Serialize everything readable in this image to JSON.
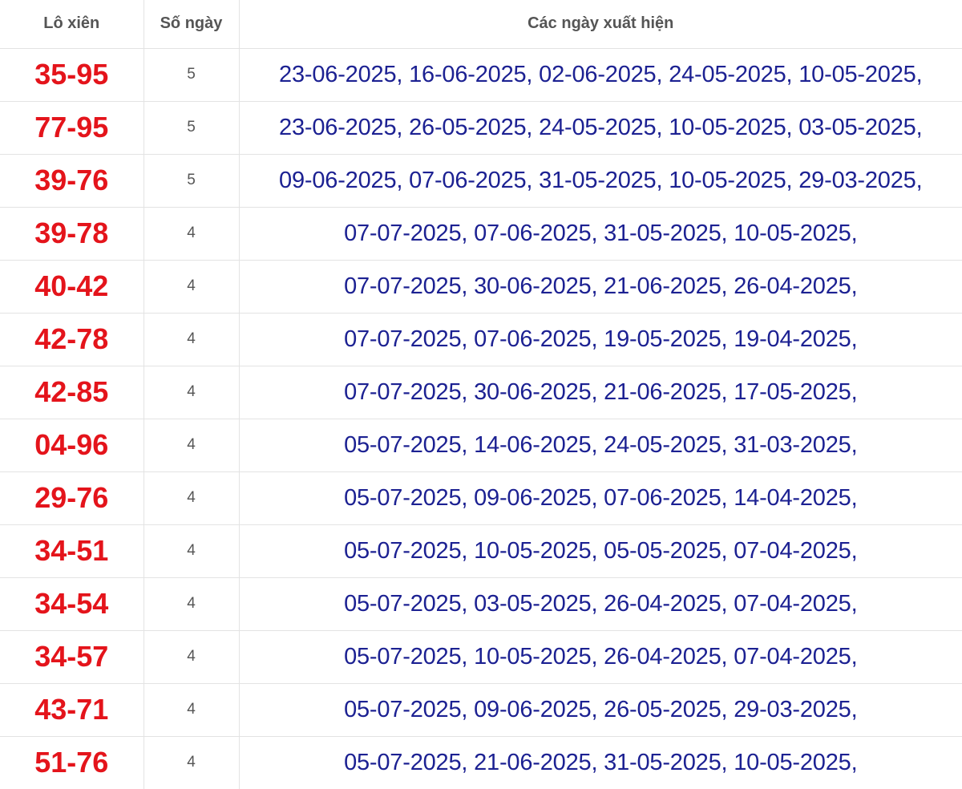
{
  "table": {
    "headers": {
      "pair": "Lô xiên",
      "days": "Số ngày",
      "dates": "Các ngày xuất hiện"
    },
    "rows": [
      {
        "pair": "35-95",
        "days": "5",
        "dates": "23-06-2025, 16-06-2025, 02-06-2025, 24-05-2025, 10-05-2025,"
      },
      {
        "pair": "77-95",
        "days": "5",
        "dates": "23-06-2025, 26-05-2025, 24-05-2025, 10-05-2025, 03-05-2025,"
      },
      {
        "pair": "39-76",
        "days": "5",
        "dates": "09-06-2025, 07-06-2025, 31-05-2025, 10-05-2025, 29-03-2025,"
      },
      {
        "pair": "39-78",
        "days": "4",
        "dates": "07-07-2025, 07-06-2025, 31-05-2025, 10-05-2025,"
      },
      {
        "pair": "40-42",
        "days": "4",
        "dates": "07-07-2025, 30-06-2025, 21-06-2025, 26-04-2025,"
      },
      {
        "pair": "42-78",
        "days": "4",
        "dates": "07-07-2025, 07-06-2025, 19-05-2025, 19-04-2025,"
      },
      {
        "pair": "42-85",
        "days": "4",
        "dates": "07-07-2025, 30-06-2025, 21-06-2025, 17-05-2025,"
      },
      {
        "pair": "04-96",
        "days": "4",
        "dates": "05-07-2025, 14-06-2025, 24-05-2025, 31-03-2025,"
      },
      {
        "pair": "29-76",
        "days": "4",
        "dates": "05-07-2025, 09-06-2025, 07-06-2025, 14-04-2025,"
      },
      {
        "pair": "34-51",
        "days": "4",
        "dates": "05-07-2025, 10-05-2025, 05-05-2025, 07-04-2025,"
      },
      {
        "pair": "34-54",
        "days": "4",
        "dates": "05-07-2025, 03-05-2025, 26-04-2025, 07-04-2025,"
      },
      {
        "pair": "34-57",
        "days": "4",
        "dates": "05-07-2025, 10-05-2025, 26-04-2025, 07-04-2025,"
      },
      {
        "pair": "43-71",
        "days": "4",
        "dates": "05-07-2025, 09-06-2025, 26-05-2025, 29-03-2025,"
      },
      {
        "pair": "51-76",
        "days": "4",
        "dates": "05-07-2025, 21-06-2025, 31-05-2025, 10-05-2025,"
      }
    ]
  },
  "colors": {
    "pair_text": "#e4141b",
    "dates_text": "#1c2192",
    "header_text": "#555555",
    "grid_line": "#e3e3e3"
  }
}
